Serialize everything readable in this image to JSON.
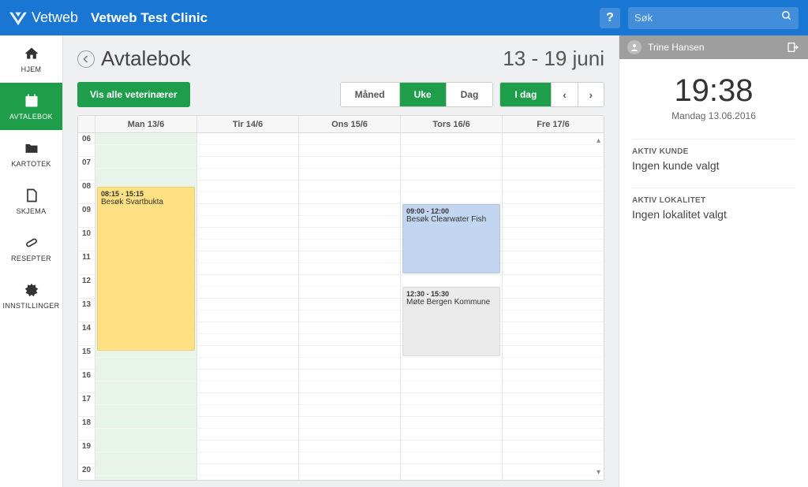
{
  "topbar": {
    "brand": "Vetweb",
    "clinic": "Vetweb Test Clinic",
    "help": "?",
    "search_placeholder": "Søk"
  },
  "sidebar": {
    "items": [
      {
        "label": "HJEM"
      },
      {
        "label": "AVTALEBOK"
      },
      {
        "label": "KARTOTEK"
      },
      {
        "label": "SKJEMA"
      },
      {
        "label": "RESEPTER"
      },
      {
        "label": "INNSTILLINGER"
      }
    ]
  },
  "page": {
    "title": "Avtalebok",
    "date_range": "13 - 19 juni",
    "show_all": "Vis alle veterinærer",
    "view": {
      "month": "Måned",
      "week": "Uke",
      "day": "Dag",
      "active": "week"
    },
    "today": "I dag"
  },
  "calendar": {
    "days": [
      "Man 13/6",
      "Tir 14/6",
      "Ons 15/6",
      "Tors 16/6",
      "Fre 17/6"
    ],
    "today_index": 0,
    "hours": [
      "06",
      "07",
      "08",
      "09",
      "10",
      "11",
      "12",
      "13",
      "14",
      "15",
      "16",
      "17",
      "18",
      "19",
      "20"
    ],
    "events": [
      {
        "day": 0,
        "time": "08:15 - 15:15",
        "title": "Besøk Svartbukta",
        "top_hour": 8.25,
        "duration": 7.0,
        "color": "yellow"
      },
      {
        "day": 3,
        "time": "09:00 - 12:00",
        "title": "Besøk Clearwater Fish",
        "top_hour": 9.0,
        "duration": 3.0,
        "color": "blue"
      },
      {
        "day": 3,
        "time": "12:30 - 15:30",
        "title": "Møte Bergen Kommune",
        "top_hour": 12.5,
        "duration": 3.0,
        "color": "grey"
      }
    ]
  },
  "rightpanel": {
    "user": "Trine Hansen",
    "time": "19:38",
    "date": "Mandag 13.06.2016",
    "active_customer_label": "AKTIV KUNDE",
    "active_customer_value": "Ingen kunde valgt",
    "active_location_label": "AKTIV LOKALITET",
    "active_location_value": "Ingen lokalitet valgt"
  }
}
